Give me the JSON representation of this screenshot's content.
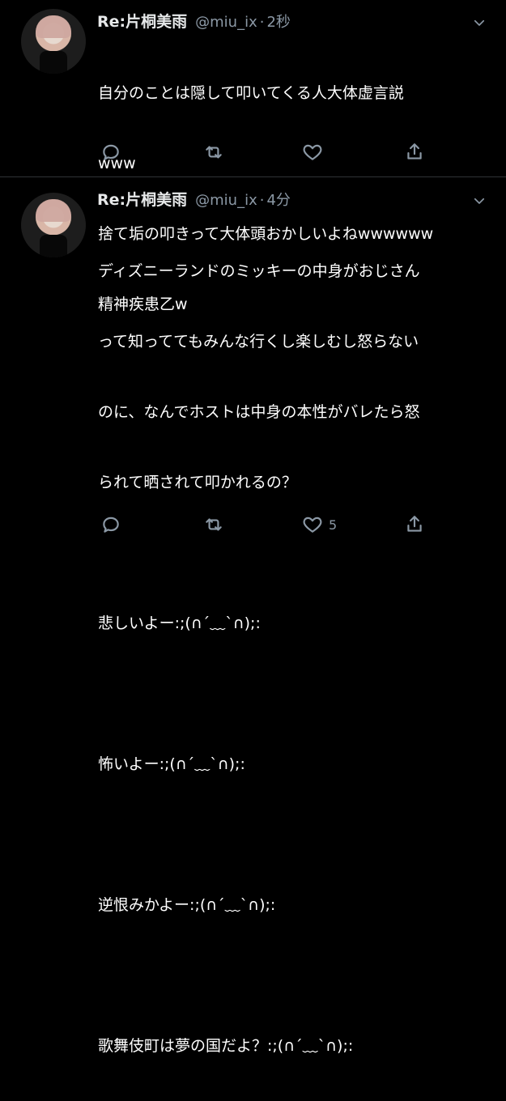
{
  "tweets": [
    {
      "display_name": "Re:片桐美雨",
      "handle": "@miu_ix",
      "separator": "·",
      "time": "2秒",
      "lines": [
        "自分のことは隠して叩いてくる人大体虚言説",
        "www",
        "捨て垢の叩きって大体頭おかしいよねwwwwww",
        "精神疾患乙w"
      ],
      "actions": {
        "reply_icon": "reply-icon",
        "retweet_icon": "retweet-icon",
        "like_icon": "heart-icon",
        "share_icon": "share-icon",
        "like_count": ""
      }
    },
    {
      "display_name": "Re:片桐美雨",
      "handle": "@miu_ix",
      "separator": "·",
      "time": "4分",
      "lines": [
        "ディズニーランドのミッキーの中身がおじさん",
        "って知っててもみんな行くし楽しむし怒らない",
        "のに、なんでホストは中身の本性がバレたら怒",
        "られて晒されて叩かれるの？",
        "",
        "悲しいよー:;(∩´﹏`∩);:",
        "",
        "怖いよー:;(∩´﹏`∩);:",
        "",
        "逆恨みかよー:;(∩´﹏`∩);:",
        "",
        "歌舞伎町は夢の国だよ？:;(∩´﹏`∩);:"
      ],
      "actions": {
        "reply_icon": "reply-icon",
        "retweet_icon": "retweet-icon",
        "like_icon": "heart-icon",
        "share_icon": "share-icon",
        "like_count": "5"
      }
    }
  ],
  "colors": {
    "background": "#000000",
    "text": "#ffffff",
    "secondary_text": "#8b98a5",
    "divider": "#2f3336"
  }
}
